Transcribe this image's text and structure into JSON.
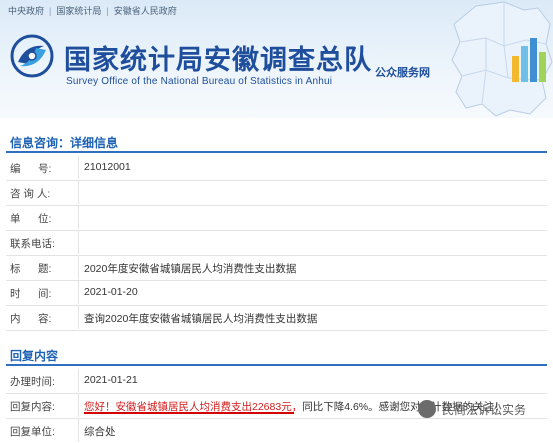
{
  "top_nav": [
    "中央政府",
    "国家统计局",
    "安徽省人民政府"
  ],
  "header": {
    "title_cn": "国家统计局安徽调查总队",
    "title_en": "Survey Office of the National Bureau of Statistics in Anhui",
    "badge": "公众服务网"
  },
  "consult": {
    "section_title": "信息咨询：详细信息",
    "rows": [
      {
        "label": "编      号:",
        "value": "21012001"
      },
      {
        "label": "咨 询 人:",
        "value": ""
      },
      {
        "label": "单      位:",
        "value": ""
      },
      {
        "label": "联系电话:",
        "value": ""
      },
      {
        "label": "标      题:",
        "value": "2020年度安徽省城镇居民人均消费性支出数据"
      },
      {
        "label": "时      间:",
        "value": "2021-01-20"
      },
      {
        "label": "内      容:",
        "value": "查询2020年度安徽省城镇居民人均消费性支出数据"
      }
    ]
  },
  "reply": {
    "section_title": "回复内容",
    "date_label": "办理时间:",
    "date_value": "2021-01-21",
    "content_label": "回复内容:",
    "content_red": "您好！安徽省城镇居民人均消费支出22683元，",
    "content_rest": "同比下降4.6%。感谢您对统计数据的关注！",
    "unit_label": "回复单位:",
    "unit_value": "综合处"
  },
  "watermark": "民商法诉讼实务",
  "colors": {
    "brand_blue": "#1e4e9c",
    "section_blue": "#1e62b5",
    "highlight_red": "#d40000"
  }
}
